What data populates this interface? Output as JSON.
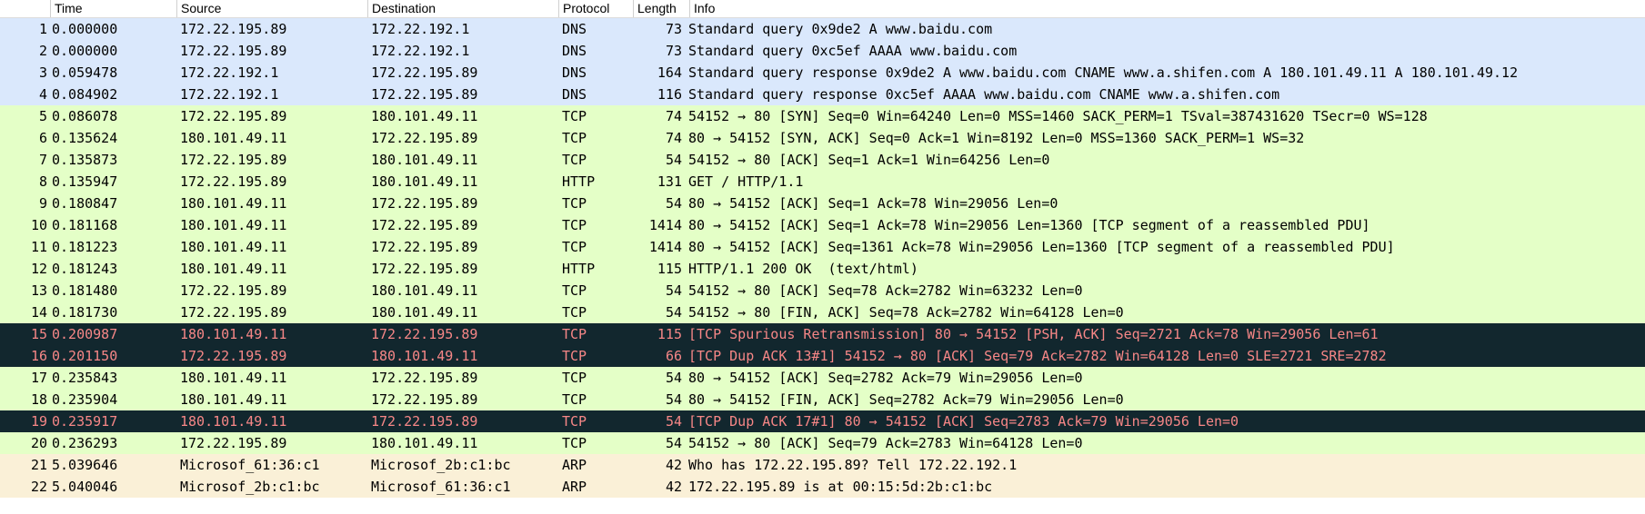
{
  "columns": {
    "no": "",
    "time": "Time",
    "source": "Source",
    "destination": "Destination",
    "protocol": "Protocol",
    "length": "Length",
    "info": "Info"
  },
  "colors": {
    "dns": {
      "bg": "#dae8fc",
      "fg": "#000000"
    },
    "tcp": {
      "bg": "#e4ffc7",
      "fg": "#000000"
    },
    "http": {
      "bg": "#e4ffc7",
      "fg": "#000000"
    },
    "tcp_bad": {
      "bg": "#12272e",
      "fg": "#f78787"
    },
    "arp": {
      "bg": "#faf0d7",
      "fg": "#000000"
    }
  },
  "packets": [
    {
      "no": "1",
      "time": "0.000000",
      "source": "172.22.195.89",
      "destination": "172.22.192.1",
      "protocol": "DNS",
      "length": "73",
      "info": "Standard query 0x9de2 A www.baidu.com",
      "style": "dns"
    },
    {
      "no": "2",
      "time": "0.000000",
      "source": "172.22.195.89",
      "destination": "172.22.192.1",
      "protocol": "DNS",
      "length": "73",
      "info": "Standard query 0xc5ef AAAA www.baidu.com",
      "style": "dns"
    },
    {
      "no": "3",
      "time": "0.059478",
      "source": "172.22.192.1",
      "destination": "172.22.195.89",
      "protocol": "DNS",
      "length": "164",
      "info": "Standard query response 0x9de2 A www.baidu.com CNAME www.a.shifen.com A 180.101.49.11 A 180.101.49.12",
      "style": "dns"
    },
    {
      "no": "4",
      "time": "0.084902",
      "source": "172.22.192.1",
      "destination": "172.22.195.89",
      "protocol": "DNS",
      "length": "116",
      "info": "Standard query response 0xc5ef AAAA www.baidu.com CNAME www.a.shifen.com",
      "style": "dns"
    },
    {
      "no": "5",
      "time": "0.086078",
      "source": "172.22.195.89",
      "destination": "180.101.49.11",
      "protocol": "TCP",
      "length": "74",
      "info": "54152 → 80 [SYN] Seq=0 Win=64240 Len=0 MSS=1460 SACK_PERM=1 TSval=387431620 TSecr=0 WS=128",
      "style": "tcp"
    },
    {
      "no": "6",
      "time": "0.135624",
      "source": "180.101.49.11",
      "destination": "172.22.195.89",
      "protocol": "TCP",
      "length": "74",
      "info": "80 → 54152 [SYN, ACK] Seq=0 Ack=1 Win=8192 Len=0 MSS=1360 SACK_PERM=1 WS=32",
      "style": "tcp"
    },
    {
      "no": "7",
      "time": "0.135873",
      "source": "172.22.195.89",
      "destination": "180.101.49.11",
      "protocol": "TCP",
      "length": "54",
      "info": "54152 → 80 [ACK] Seq=1 Ack=1 Win=64256 Len=0",
      "style": "tcp"
    },
    {
      "no": "8",
      "time": "0.135947",
      "source": "172.22.195.89",
      "destination": "180.101.49.11",
      "protocol": "HTTP",
      "length": "131",
      "info": "GET / HTTP/1.1",
      "style": "http"
    },
    {
      "no": "9",
      "time": "0.180847",
      "source": "180.101.49.11",
      "destination": "172.22.195.89",
      "protocol": "TCP",
      "length": "54",
      "info": "80 → 54152 [ACK] Seq=1 Ack=78 Win=29056 Len=0",
      "style": "tcp"
    },
    {
      "no": "10",
      "time": "0.181168",
      "source": "180.101.49.11",
      "destination": "172.22.195.89",
      "protocol": "TCP",
      "length": "1414",
      "info": "80 → 54152 [ACK] Seq=1 Ack=78 Win=29056 Len=1360 [TCP segment of a reassembled PDU]",
      "style": "tcp"
    },
    {
      "no": "11",
      "time": "0.181223",
      "source": "180.101.49.11",
      "destination": "172.22.195.89",
      "protocol": "TCP",
      "length": "1414",
      "info": "80 → 54152 [ACK] Seq=1361 Ack=78 Win=29056 Len=1360 [TCP segment of a reassembled PDU]",
      "style": "tcp"
    },
    {
      "no": "12",
      "time": "0.181243",
      "source": "180.101.49.11",
      "destination": "172.22.195.89",
      "protocol": "HTTP",
      "length": "115",
      "info": "HTTP/1.1 200 OK  (text/html)",
      "style": "http"
    },
    {
      "no": "13",
      "time": "0.181480",
      "source": "172.22.195.89",
      "destination": "180.101.49.11",
      "protocol": "TCP",
      "length": "54",
      "info": "54152 → 80 [ACK] Seq=78 Ack=2782 Win=63232 Len=0",
      "style": "tcp"
    },
    {
      "no": "14",
      "time": "0.181730",
      "source": "172.22.195.89",
      "destination": "180.101.49.11",
      "protocol": "TCP",
      "length": "54",
      "info": "54152 → 80 [FIN, ACK] Seq=78 Ack=2782 Win=64128 Len=0",
      "style": "tcp"
    },
    {
      "no": "15",
      "time": "0.200987",
      "source": "180.101.49.11",
      "destination": "172.22.195.89",
      "protocol": "TCP",
      "length": "115",
      "info": "[TCP Spurious Retransmission] 80 → 54152 [PSH, ACK] Seq=2721 Ack=78 Win=29056 Len=61",
      "style": "tcp_bad"
    },
    {
      "no": "16",
      "time": "0.201150",
      "source": "172.22.195.89",
      "destination": "180.101.49.11",
      "protocol": "TCP",
      "length": "66",
      "info": "[TCP Dup ACK 13#1] 54152 → 80 [ACK] Seq=79 Ack=2782 Win=64128 Len=0 SLE=2721 SRE=2782",
      "style": "tcp_bad"
    },
    {
      "no": "17",
      "time": "0.235843",
      "source": "180.101.49.11",
      "destination": "172.22.195.89",
      "protocol": "TCP",
      "length": "54",
      "info": "80 → 54152 [ACK] Seq=2782 Ack=79 Win=29056 Len=0",
      "style": "tcp"
    },
    {
      "no": "18",
      "time": "0.235904",
      "source": "180.101.49.11",
      "destination": "172.22.195.89",
      "protocol": "TCP",
      "length": "54",
      "info": "80 → 54152 [FIN, ACK] Seq=2782 Ack=79 Win=29056 Len=0",
      "style": "tcp"
    },
    {
      "no": "19",
      "time": "0.235917",
      "source": "180.101.49.11",
      "destination": "172.22.195.89",
      "protocol": "TCP",
      "length": "54",
      "info": "[TCP Dup ACK 17#1] 80 → 54152 [ACK] Seq=2783 Ack=79 Win=29056 Len=0",
      "style": "tcp_bad"
    },
    {
      "no": "20",
      "time": "0.236293",
      "source": "172.22.195.89",
      "destination": "180.101.49.11",
      "protocol": "TCP",
      "length": "54",
      "info": "54152 → 80 [ACK] Seq=79 Ack=2783 Win=64128 Len=0",
      "style": "tcp"
    },
    {
      "no": "21",
      "time": "5.039646",
      "source": "Microsof_61:36:c1",
      "destination": "Microsof_2b:c1:bc",
      "protocol": "ARP",
      "length": "42",
      "info": "Who has 172.22.195.89? Tell 172.22.192.1",
      "style": "arp"
    },
    {
      "no": "22",
      "time": "5.040046",
      "source": "Microsof_2b:c1:bc",
      "destination": "Microsof_61:36:c1",
      "protocol": "ARP",
      "length": "42",
      "info": "172.22.195.89 is at 00:15:5d:2b:c1:bc",
      "style": "arp"
    }
  ]
}
